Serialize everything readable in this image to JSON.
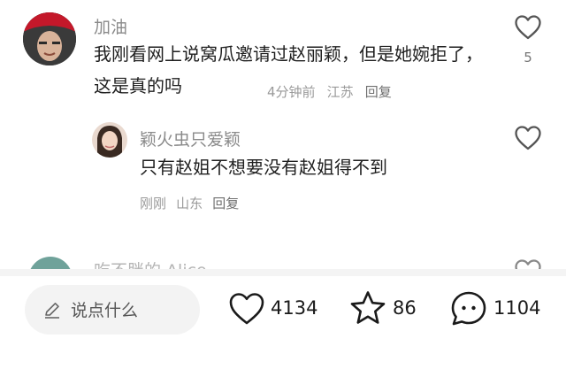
{
  "comments": [
    {
      "author": "加油",
      "text": "我刚看网上说窝瓜邀请过赵丽颖，但是她婉拒了，这是真的吗",
      "time": "4分钟前",
      "location": "江苏",
      "reply_label": "回复",
      "like_count": "5"
    }
  ],
  "reply": {
    "author": "颖火虫只爱颖",
    "text": "只有赵姐不想要没有赵姐得不到",
    "time": "刚刚",
    "location": "山东",
    "reply_label": "回复"
  },
  "next_comment": {
    "author": "吃不胖的 Alice"
  },
  "bottom_bar": {
    "input_placeholder": "说点什么",
    "likes": "4134",
    "favorites": "86",
    "comments": "1104"
  },
  "icons": {
    "heart": "heart-icon",
    "star": "star-icon",
    "chat": "chat-bubble-icon",
    "pencil": "pencil-icon"
  },
  "colors": {
    "background": "#ffffff",
    "secondary_text": "#8a8a8a",
    "input_background": "#f3f3f3"
  }
}
